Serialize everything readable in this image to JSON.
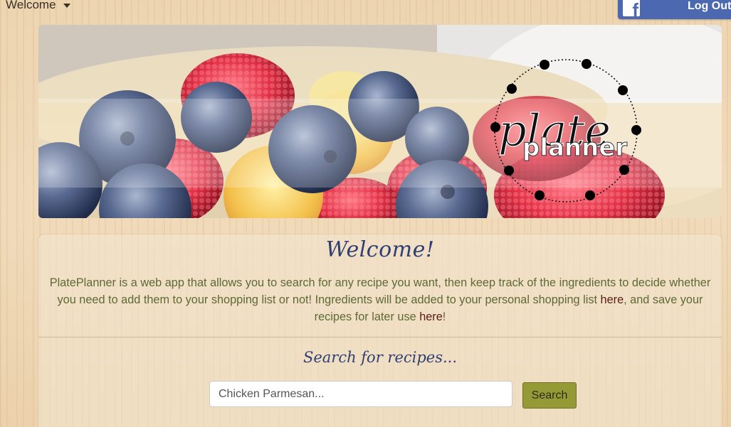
{
  "nav": {
    "welcome_label": "Welcome",
    "logout_label": "Log Out",
    "facebook_icon": "facebook-icon",
    "facebook_color": "#4c68b0"
  },
  "banner": {
    "logo_top": "plate",
    "logo_bottom": "planner"
  },
  "intro": {
    "heading": "Welcome!",
    "text_before_link1": "PlatePlanner is a web app that allows you to search for any recipe you want, then keep track of the ingredients to decide whether you need to add them to your shopping list or not! Ingredients will be added to your personal shopping list ",
    "link1_label": "here",
    "text_between_links": ", and save your recipes for later use ",
    "link2_label": "here",
    "text_after_link2": "!"
  },
  "search": {
    "heading": "Search for recipes...",
    "placeholder": "Chicken Parmesan...",
    "button_label": "Search",
    "button_color": "#969a36"
  }
}
